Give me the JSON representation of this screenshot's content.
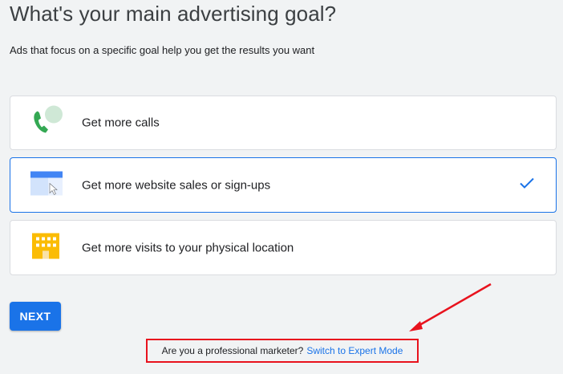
{
  "page": {
    "title": "What's your main advertising goal?",
    "subtitle": "Ads that focus on a specific goal help you get the results you want"
  },
  "goals": [
    {
      "label": "Get more calls",
      "icon": "phone-chat-icon",
      "selected": false
    },
    {
      "label": "Get more website sales or sign-ups",
      "icon": "website-cursor-icon",
      "selected": true
    },
    {
      "label": "Get more visits to your physical location",
      "icon": "building-icon",
      "selected": false
    }
  ],
  "actions": {
    "next_label": "NEXT"
  },
  "footer": {
    "question": "Are you a professional marketer?",
    "link_label": "Switch to Expert Mode"
  },
  "colors": {
    "accent": "#1a73e8",
    "annotation_red": "#e8121d",
    "phone_green": "#34a853",
    "building_yellow": "#fbbc04"
  }
}
